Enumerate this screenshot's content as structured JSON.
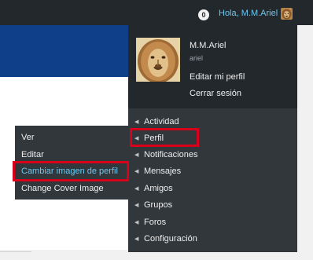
{
  "adminbar": {
    "counter": "0",
    "greeting": "Hola, M.M.Ariel",
    "avatar_icon": "lion-avatar-icon"
  },
  "profile": {
    "display_name": "M.M.Ariel",
    "username": "ariel",
    "links": [
      "Editar mi perfil",
      "Cerrar sesión"
    ]
  },
  "menu": {
    "items": [
      "Actividad",
      "Perfil",
      "Notificaciones",
      "Mensajes",
      "Amigos",
      "Grupos",
      "Foros",
      "Configuración"
    ],
    "highlighted": "Perfil"
  },
  "submenu": {
    "items": [
      "Ver",
      "Editar",
      "Cambiar imagen de perfil",
      "Change Cover Image"
    ],
    "active": "Cambiar imagen de perfil"
  },
  "colors": {
    "adminbar_bg": "#23282d",
    "menu_bg": "#32373c",
    "link_blue": "#6ac7f1",
    "highlight_red": "#d9001b",
    "header_blue": "#0f3f88"
  }
}
